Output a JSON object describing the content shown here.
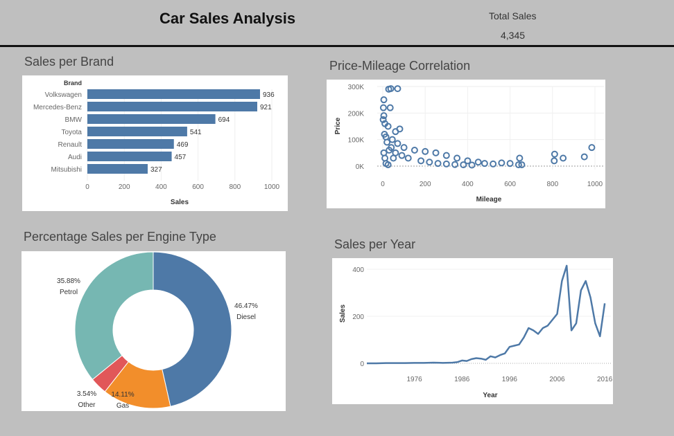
{
  "header": {
    "title": "Car Sales Analysis",
    "total_label": "Total Sales",
    "total_value": "4,345"
  },
  "sections": {
    "brand": "Sales per Brand",
    "scatter": "Price-Mileage Correlation",
    "engine": "Percentage Sales per Engine Type",
    "year": "Sales per Year"
  },
  "colors": {
    "background": "#bfbfbf",
    "bar": "#4e79a7",
    "diesel": "#4e79a7",
    "gas": "#f28e2b",
    "other": "#e15759",
    "petrol": "#76b7b2"
  },
  "chart_data": [
    {
      "type": "bar",
      "orientation": "horizontal",
      "ylabel": "Brand",
      "xlabel": "Sales",
      "categories": [
        "Volkswagen",
        "Mercedes-Benz",
        "BMW",
        "Toyota",
        "Renault",
        "Audi",
        "Mitsubishi"
      ],
      "values": [
        936,
        921,
        694,
        541,
        469,
        457,
        327
      ],
      "xlim": [
        0,
        1000
      ],
      "xticks": [
        "0",
        "200",
        "400",
        "600",
        "800",
        "1000"
      ]
    },
    {
      "type": "scatter",
      "xlabel": "Mileage",
      "ylabel": "Price",
      "xlim": [
        0,
        1000
      ],
      "ylim": [
        0,
        300000
      ],
      "xticks": [
        "0",
        "200",
        "400",
        "600",
        "800",
        "1000"
      ],
      "yticks": [
        "0K",
        "100K",
        "200K",
        "300K"
      ],
      "points": [
        [
          28,
          290000
        ],
        [
          38,
          292000
        ],
        [
          70,
          292000
        ],
        [
          5,
          250000
        ],
        [
          3,
          220000
        ],
        [
          35,
          220000
        ],
        [
          5,
          190000
        ],
        [
          2,
          175000
        ],
        [
          60,
          130000
        ],
        [
          80,
          140000
        ],
        [
          10,
          160000
        ],
        [
          25,
          150000
        ],
        [
          8,
          120000
        ],
        [
          15,
          110000
        ],
        [
          45,
          100000
        ],
        [
          70,
          85000
        ],
        [
          100,
          70000
        ],
        [
          150,
          60000
        ],
        [
          200,
          55000
        ],
        [
          250,
          50000
        ],
        [
          300,
          40000
        ],
        [
          350,
          30000
        ],
        [
          400,
          20000
        ],
        [
          450,
          15000
        ],
        [
          480,
          10000
        ],
        [
          520,
          8000
        ],
        [
          560,
          12000
        ],
        [
          600,
          10000
        ],
        [
          640,
          5000
        ],
        [
          655,
          5000
        ],
        [
          645,
          30000
        ],
        [
          810,
          45000
        ],
        [
          808,
          20000
        ],
        [
          850,
          30000
        ],
        [
          950,
          35000
        ],
        [
          985,
          70000
        ],
        [
          20,
          90000
        ],
        [
          40,
          70000
        ],
        [
          60,
          50000
        ],
        [
          90,
          40000
        ],
        [
          120,
          30000
        ],
        [
          180,
          20000
        ],
        [
          220,
          15000
        ],
        [
          260,
          10000
        ],
        [
          300,
          8000
        ],
        [
          340,
          6000
        ],
        [
          380,
          5000
        ],
        [
          420,
          4000
        ],
        [
          30,
          60000
        ],
        [
          50,
          30000
        ],
        [
          5,
          50000
        ],
        [
          10,
          30000
        ],
        [
          15,
          10000
        ],
        [
          25,
          5000
        ]
      ]
    },
    {
      "type": "pie",
      "donut": true,
      "slices": [
        {
          "label": "Diesel",
          "percent": 46.47,
          "display": "46.47%"
        },
        {
          "label": "Gas",
          "percent": 14.11,
          "display": "14.11%"
        },
        {
          "label": "Other",
          "percent": 3.54,
          "display": "3.54%"
        },
        {
          "label": "Petrol",
          "percent": 35.88,
          "display": "35.88%"
        }
      ]
    },
    {
      "type": "line",
      "xlabel": "Year",
      "ylabel": "Sales",
      "xlim": [
        1966,
        2017
      ],
      "ylim": [
        0,
        400
      ],
      "xticks": [
        "1976",
        "1986",
        "1996",
        "2006",
        "2016"
      ],
      "yticks": [
        "0",
        "200",
        "400"
      ],
      "x": [
        1966,
        1968,
        1970,
        1972,
        1974,
        1976,
        1978,
        1980,
        1982,
        1984,
        1985,
        1986,
        1987,
        1988,
        1989,
        1990,
        1991,
        1992,
        1993,
        1994,
        1995,
        1996,
        1997,
        1998,
        1999,
        2000,
        2001,
        2002,
        2003,
        2004,
        2005,
        2006,
        2007,
        2008,
        2009,
        2010,
        2011,
        2012,
        2013,
        2014,
        2015,
        2016
      ],
      "values": [
        0,
        0,
        1,
        1,
        1,
        2,
        2,
        3,
        2,
        3,
        5,
        12,
        10,
        18,
        22,
        20,
        15,
        30,
        25,
        35,
        42,
        70,
        75,
        80,
        110,
        150,
        140,
        125,
        150,
        160,
        185,
        210,
        350,
        415,
        140,
        170,
        310,
        350,
        280,
        170,
        115,
        255
      ]
    }
  ]
}
